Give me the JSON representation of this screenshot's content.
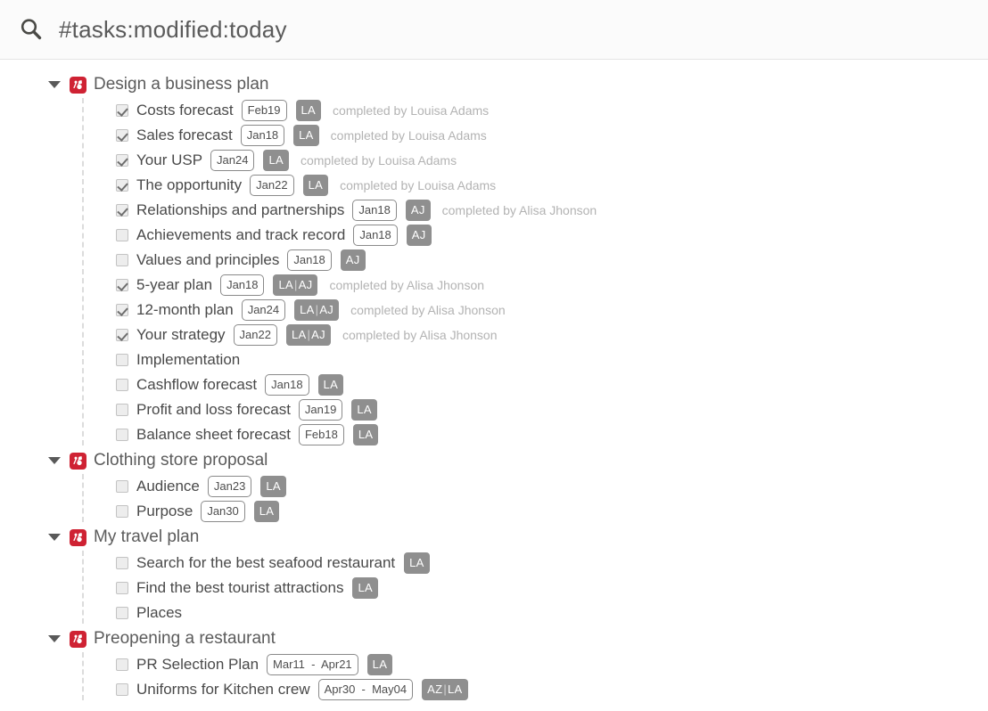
{
  "search": {
    "icon": "search-icon",
    "query": "#tasks:modified:today"
  },
  "colors": {
    "project_icon": "#cf2233",
    "avatar_chip": "#8f8f8f",
    "task_text": "#494949",
    "muted_text": "#b3b3b3"
  },
  "groups": [
    {
      "title": "Design a business plan",
      "icon": "project-icon",
      "expanded": true,
      "tasks": [
        {
          "title": "Costs forecast",
          "checked": true,
          "date": "Feb19",
          "avatars": [
            "LA"
          ],
          "completed_by": "completed by Louisa Adams"
        },
        {
          "title": "Sales forecast",
          "checked": true,
          "date": "Jan18",
          "avatars": [
            "LA"
          ],
          "completed_by": "completed by Louisa Adams"
        },
        {
          "title": "Your USP",
          "checked": true,
          "date": "Jan24",
          "avatars": [
            "LA"
          ],
          "completed_by": "completed by Louisa Adams"
        },
        {
          "title": "The opportunity",
          "checked": true,
          "date": "Jan22",
          "avatars": [
            "LA"
          ],
          "completed_by": "completed by Louisa Adams"
        },
        {
          "title": "Relationships and partnerships",
          "checked": true,
          "date": "Jan18",
          "avatars": [
            "AJ"
          ],
          "completed_by": "completed by Alisa Jhonson"
        },
        {
          "title": "Achievements and track record",
          "checked": false,
          "date": "Jan18",
          "avatars": [
            "AJ"
          ],
          "completed_by": ""
        },
        {
          "title": "Values and principles",
          "checked": false,
          "date": "Jan18",
          "avatars": [
            "AJ"
          ],
          "completed_by": ""
        },
        {
          "title": "5-year plan",
          "checked": true,
          "date": "Jan18",
          "avatars": [
            "LA",
            "AJ"
          ],
          "completed_by": "completed by Alisa Jhonson"
        },
        {
          "title": "12-month plan",
          "checked": true,
          "date": "Jan24",
          "avatars": [
            "LA",
            "AJ"
          ],
          "completed_by": "completed by Alisa Jhonson"
        },
        {
          "title": "Your strategy",
          "checked": true,
          "date": "Jan22",
          "avatars": [
            "LA",
            "AJ"
          ],
          "completed_by": "completed by Alisa Jhonson"
        },
        {
          "title": "Implementation",
          "checked": false,
          "date": "",
          "avatars": [],
          "completed_by": ""
        },
        {
          "title": "Cashflow forecast",
          "checked": false,
          "date": "Jan18",
          "avatars": [
            "LA"
          ],
          "completed_by": ""
        },
        {
          "title": "Profit and loss forecast",
          "checked": false,
          "date": "Jan19",
          "avatars": [
            "LA"
          ],
          "completed_by": ""
        },
        {
          "title": "Balance sheet forecast",
          "checked": false,
          "date": "Feb18",
          "avatars": [
            "LA"
          ],
          "completed_by": ""
        }
      ]
    },
    {
      "title": "Clothing store proposal",
      "icon": "project-icon",
      "expanded": true,
      "tasks": [
        {
          "title": "Audience",
          "checked": false,
          "date": "Jan23",
          "avatars": [
            "LA"
          ],
          "completed_by": ""
        },
        {
          "title": "Purpose",
          "checked": false,
          "date": "Jan30",
          "avatars": [
            "LA"
          ],
          "completed_by": ""
        }
      ]
    },
    {
      "title": "My travel plan",
      "icon": "project-icon",
      "expanded": true,
      "tasks": [
        {
          "title": "Search for the best seafood restaurant",
          "checked": false,
          "date": "",
          "avatars": [
            "LA"
          ],
          "completed_by": ""
        },
        {
          "title": "Find the best tourist attractions",
          "checked": false,
          "date": "",
          "avatars": [
            "LA"
          ],
          "completed_by": ""
        },
        {
          "title": "Places",
          "checked": false,
          "date": "",
          "avatars": [],
          "completed_by": ""
        }
      ]
    },
    {
      "title": "Preopening a restaurant",
      "icon": "project-icon",
      "expanded": true,
      "tasks": [
        {
          "title": "PR Selection Plan",
          "checked": false,
          "date": "Mar11  -  Apr21",
          "avatars": [
            "LA"
          ],
          "completed_by": ""
        },
        {
          "title": "Uniforms for Kitchen crew",
          "checked": false,
          "date": "Apr30  -  May04",
          "avatars": [
            "AZ",
            "LA"
          ],
          "completed_by": ""
        }
      ]
    }
  ]
}
